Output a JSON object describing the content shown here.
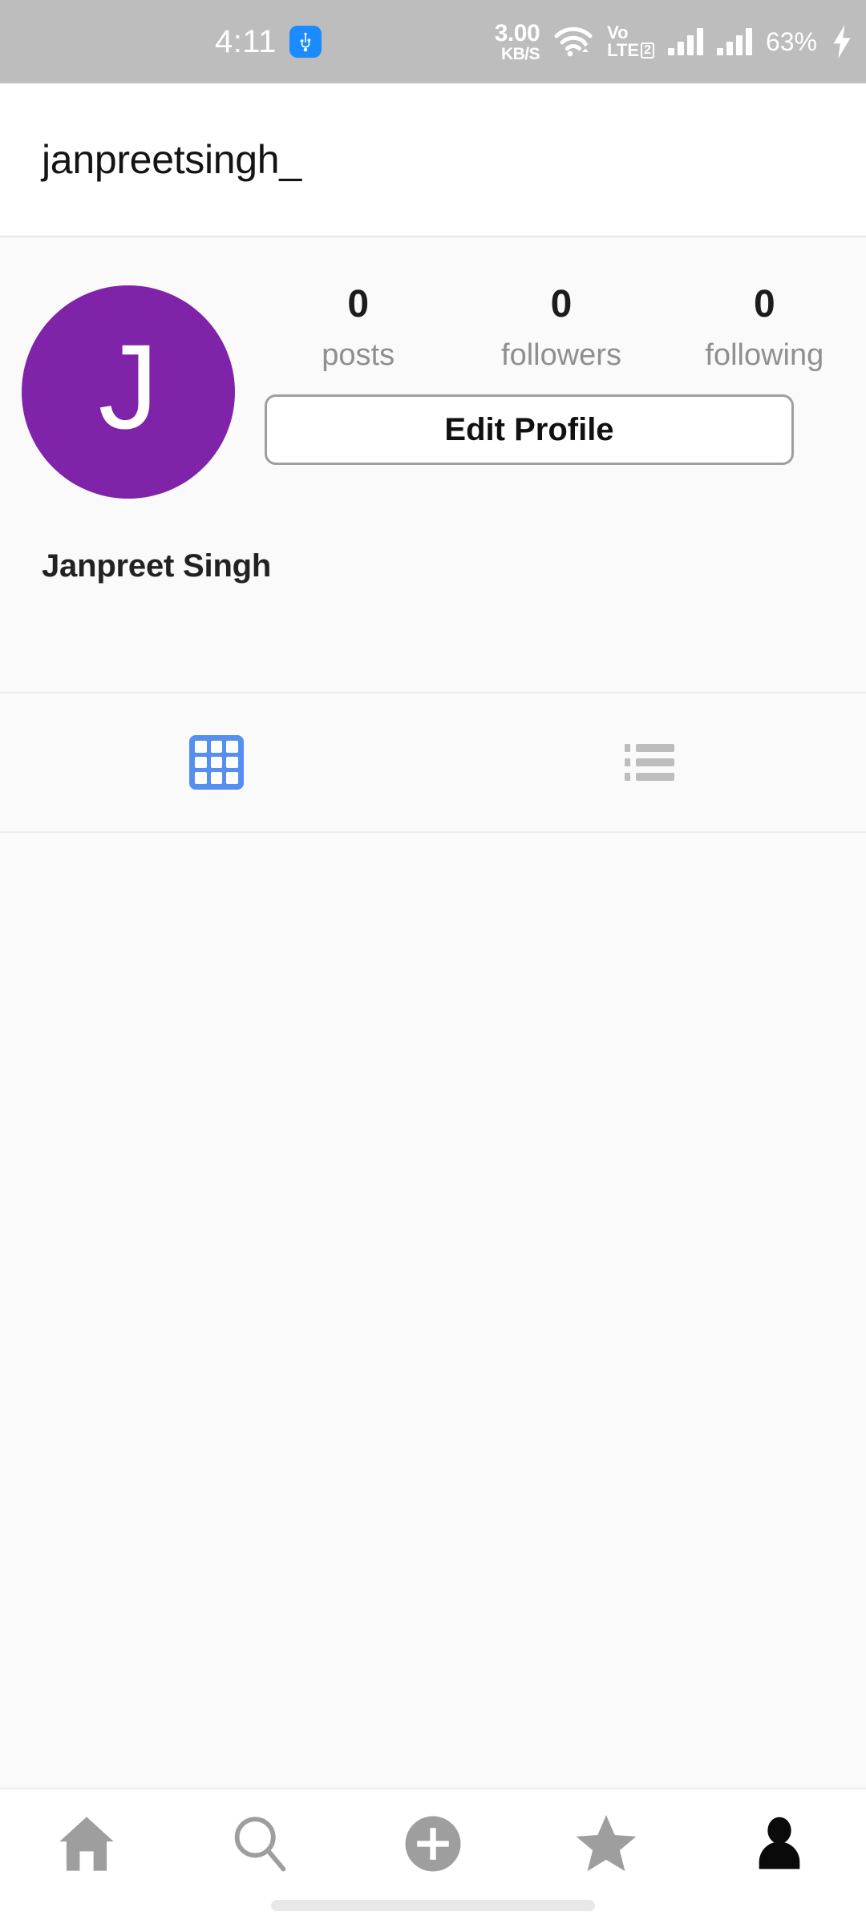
{
  "status_bar": {
    "time": "4:11",
    "usb_icon": "usb-icon",
    "network_speed_value": "3.00",
    "network_speed_unit": "KB/S",
    "wifi_icon": "wifi-icon",
    "volte_line1": "Vo",
    "volte_line2": "LTE",
    "volte_sim": "2",
    "signal_icon_1": "cellular-signal-icon",
    "signal_icon_2": "cellular-signal-icon",
    "battery_percent": "63%",
    "charging_icon": "charging-bolt-icon",
    "background_color": "#bdbdbd",
    "text_color": "#ffffff"
  },
  "title_bar": {
    "username": "janpreetsingh_"
  },
  "profile": {
    "avatar_initial": "J",
    "avatar_color": "#7f23a8",
    "display_name": "Janpreet Singh",
    "stats": [
      {
        "count": "0",
        "label": "posts"
      },
      {
        "count": "0",
        "label": "followers"
      },
      {
        "count": "0",
        "label": "following"
      }
    ],
    "edit_profile_label": "Edit Profile"
  },
  "tabs": [
    {
      "name": "grid-tab",
      "icon": "grid-icon",
      "active": true,
      "color": "#5590f0"
    },
    {
      "name": "list-tab",
      "icon": "list-icon",
      "active": false,
      "color": "#bdbdbd"
    }
  ],
  "bottom_nav": [
    {
      "name": "home",
      "icon": "home-icon",
      "active": false
    },
    {
      "name": "search",
      "icon": "search-icon",
      "active": false
    },
    {
      "name": "create",
      "icon": "plus-circle-icon",
      "active": false
    },
    {
      "name": "activity",
      "icon": "star-icon",
      "active": false
    },
    {
      "name": "profile",
      "icon": "person-icon",
      "active": true
    }
  ],
  "colors": {
    "page_background": "#fafafa",
    "inactive_icon": "#9e9e9e",
    "active_icon": "#000000",
    "accent_blue": "#5590f0"
  }
}
